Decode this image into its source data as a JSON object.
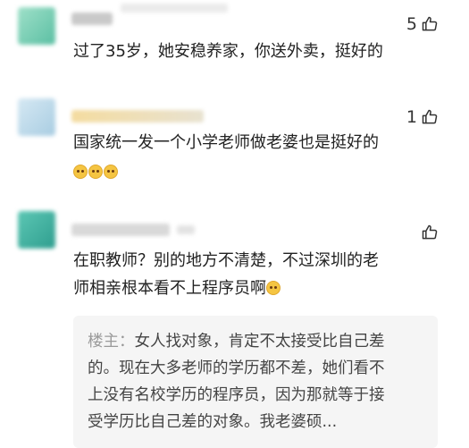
{
  "comments": [
    {
      "likes": "5",
      "text": "过了35岁，她安稳养家，你送外卖，挺好的"
    },
    {
      "likes": "1",
      "text": "国家统一发一个小学老师做老婆也是挺好的",
      "emojis": [
        "laugh-emoji",
        "laugh-emoji",
        "laugh-emoji"
      ]
    },
    {
      "likes": "",
      "text_line1": "在职教师？别的地方不清楚，不过深圳的老",
      "text_line2": "师相亲根本看不上程序员啊",
      "emoji": "cry-laugh-emoji",
      "quote": {
        "author": "楼主：",
        "line1": "女人找对象，肯定不太接受比自己差",
        "line2": "的。现在大多老师的学历都不差，她们看不",
        "line3": "上没有名校学历的程序员，因为那就等于接",
        "line4": "受学历比自己差的对象。我老婆硕..."
      }
    }
  ],
  "colors": {
    "text": "#222222",
    "quote_bg": "#f5f5f5",
    "quote_author": "#9a9a9a",
    "avatar1": "#7fd0b8",
    "avatar2": "#b9d8ea",
    "avatar3": "#4db8a8"
  }
}
